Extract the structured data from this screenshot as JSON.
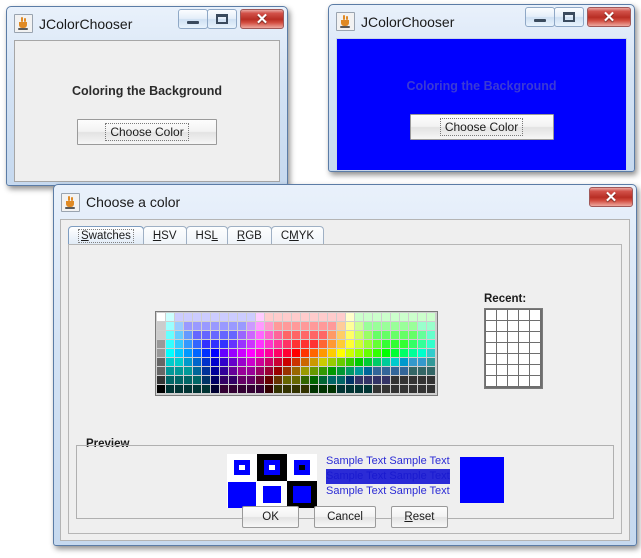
{
  "windows": {
    "win1": {
      "title": "JColorChooser",
      "icon": "java-cup-icon",
      "label": "Coloring the Background",
      "button": "Choose Color",
      "background": "#efefef",
      "controls": {
        "minimize": "–",
        "maximize": "□",
        "close": "✕"
      }
    },
    "win2": {
      "title": "JColorChooser",
      "icon": "java-cup-icon",
      "label": "Coloring the Background",
      "button": "Choose Color",
      "background": "#0000ff",
      "controls": {
        "minimize": "–",
        "maximize": "□",
        "close": "✕"
      }
    }
  },
  "dialog": {
    "title": "Choose a color",
    "icon": "java-cup-icon",
    "controls": {
      "close": "✕"
    },
    "tabs": [
      {
        "label": "Swatches",
        "mnemonic": "S",
        "selected": true
      },
      {
        "label": "HSV",
        "mnemonic": "H",
        "selected": false
      },
      {
        "label": "HSL",
        "mnemonic": "L",
        "selected": false
      },
      {
        "label": "RGB",
        "mnemonic": "R",
        "selected": false
      },
      {
        "label": "CMYK",
        "mnemonic": "M",
        "selected": false
      }
    ],
    "swatches": {
      "columns": 31,
      "rows": 9
    },
    "recent": {
      "title": "Recent:",
      "columns": 5,
      "rows": 7,
      "color": "#ffffff"
    },
    "preview": {
      "legend": "Preview",
      "selected_color": "#0000ff",
      "sample_rows": [
        {
          "text": "Sample Text  Sample Text",
          "highlighted": false
        },
        {
          "text": "Sample Text  Sample Text",
          "highlighted": true
        },
        {
          "text": "Sample Text  Sample Text",
          "highlighted": false
        }
      ]
    },
    "buttons": [
      {
        "label": "OK",
        "mnemonic": ""
      },
      {
        "label": "Cancel",
        "mnemonic": ""
      },
      {
        "label": "Reset",
        "mnemonic": "R"
      }
    ]
  }
}
